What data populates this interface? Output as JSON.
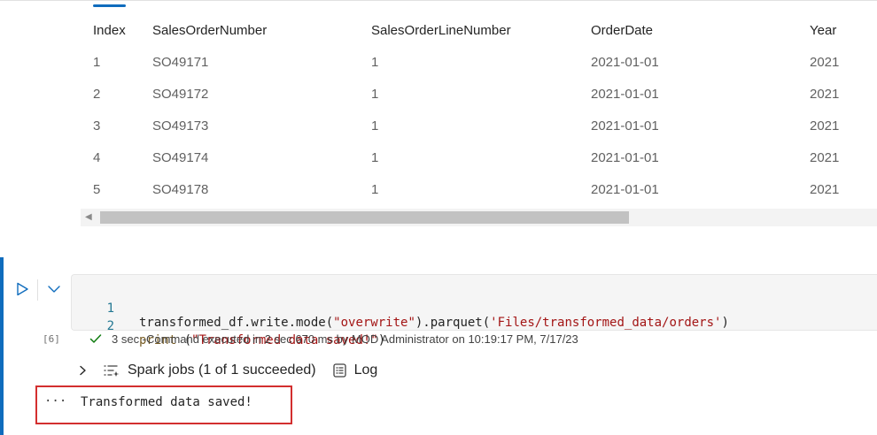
{
  "table": {
    "headers": [
      "Index",
      "SalesOrderNumber",
      "SalesOrderLineNumber",
      "OrderDate",
      "Year"
    ],
    "rows": [
      [
        "1",
        "SO49171",
        "1",
        "2021-01-01",
        "2021"
      ],
      [
        "2",
        "SO49172",
        "1",
        "2021-01-01",
        "2021"
      ],
      [
        "3",
        "SO49173",
        "1",
        "2021-01-01",
        "2021"
      ],
      [
        "4",
        "SO49174",
        "1",
        "2021-01-01",
        "2021"
      ],
      [
        "5",
        "SO49178",
        "1",
        "2021-01-01",
        "2021"
      ]
    ]
  },
  "cell": {
    "execution_count": "[6]",
    "lines": [
      {
        "number": "1",
        "parts": [
          {
            "text": "transformed_df.write.mode(",
            "kind": "plain"
          },
          {
            "text": "\"overwrite\"",
            "kind": "str"
          },
          {
            "text": ").parquet(",
            "kind": "plain"
          },
          {
            "text": "'Files/transformed_data/orders'",
            "kind": "str"
          },
          {
            "text": ")",
            "kind": "plain"
          }
        ]
      },
      {
        "number": "2",
        "parts": [
          {
            "text": "print",
            "kind": "kw"
          },
          {
            "text": " (",
            "kind": "plain"
          },
          {
            "text": "\"Transformed data saved!\"",
            "kind": "str"
          },
          {
            "text": ")",
            "kind": "plain"
          }
        ]
      }
    ],
    "status_text": "3 sec -Command executed in 2 sec 670 ms by MOD Administrator on 10:19:17 PM, 7/17/23"
  },
  "spark": {
    "jobs_label": "Spark jobs (1 of 1 succeeded)",
    "log_label": "Log"
  },
  "output": {
    "ellipsis": "···",
    "text": "Transformed data saved!"
  },
  "icons": {
    "run": "run-cell-icon",
    "collapse": "chevron-down-icon",
    "success": "checkmark-icon",
    "expand": "chevron-right-icon",
    "jobs": "spark-jobs-icon",
    "log": "log-icon"
  },
  "colors": {
    "accent": "#0f6cbd",
    "success": "#107c10",
    "highlight_box": "#d32f2f",
    "string": "#a31515",
    "keyword": "#795e26"
  }
}
